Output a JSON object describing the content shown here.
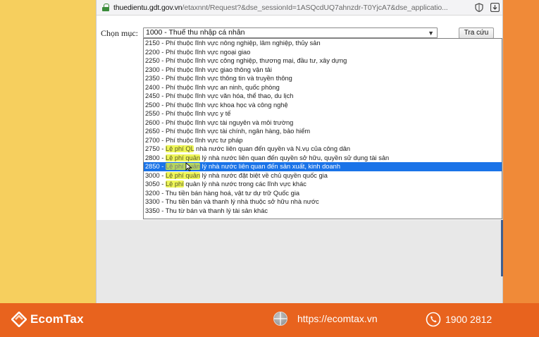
{
  "browser": {
    "url_host": "thuedientu.gdt.gov.vn",
    "url_path": "/etaxnnt/Request?&dse_sessionId=1ASQcdUQ7ahnzdr-T0YjcA7&dse_applicatio..."
  },
  "form": {
    "label": "Chọn mục:",
    "selected_value": "1000 - Thuế thu nhập cá nhân",
    "search_button": "Tra cứu"
  },
  "dropdown": {
    "options": [
      {
        "code": "2150",
        "prefix": "",
        "hl": "",
        "rest": "Phí thuộc lĩnh vực nông nghiệp, lâm nghiệp, thủy sản"
      },
      {
        "code": "2200",
        "prefix": "",
        "hl": "",
        "rest": "Phí thuộc lĩnh vực ngoại giao"
      },
      {
        "code": "2250",
        "prefix": "",
        "hl": "",
        "rest": "Phí thuộc lĩnh vực công nghiệp, thương mại, đầu tư, xây dựng"
      },
      {
        "code": "2300",
        "prefix": "",
        "hl": "",
        "rest": "Phí thuộc lĩnh vực giao thông vận tải"
      },
      {
        "code": "2350",
        "prefix": "",
        "hl": "",
        "rest": "Phí thuộc lĩnh vực thông tin và truyền thông"
      },
      {
        "code": "2400",
        "prefix": "",
        "hl": "",
        "rest": "Phí thuộc lĩnh vực an ninh, quốc phòng"
      },
      {
        "code": "2450",
        "prefix": "",
        "hl": "",
        "rest": "Phí thuộc lĩnh vực văn hóa, thể thao, du lịch"
      },
      {
        "code": "2500",
        "prefix": "",
        "hl": "",
        "rest": "Phí thuộc lĩnh vực khoa học và công nghệ"
      },
      {
        "code": "2550",
        "prefix": "",
        "hl": "",
        "rest": "Phí thuộc lĩnh vực y tế"
      },
      {
        "code": "2600",
        "prefix": "",
        "hl": "",
        "rest": "Phí thuộc lĩnh vực tài nguyên và môi trường"
      },
      {
        "code": "2650",
        "prefix": "",
        "hl": "",
        "rest": "Phí thuộc lĩnh vực tài chính, ngân hàng, bảo hiểm"
      },
      {
        "code": "2700",
        "prefix": "",
        "hl": "",
        "rest": "Phí thuộc lĩnh vực tư pháp"
      },
      {
        "code": "2750",
        "prefix": "",
        "hl": "Lệ phí QL",
        "rest": " nhà nước liên quan đến quyền và N.vụ của công dân"
      },
      {
        "code": "2800",
        "prefix": "",
        "hl": "Lệ phí quản",
        "rest": " lý nhà nước liên quan đến quyền sở hữu, quyền sử dụng tài sản"
      },
      {
        "code": "2850",
        "prefix": "",
        "hl": "Lệ phí quản",
        "rest": " lý nhà nước liên quan đến sản xuất, kinh doanh",
        "selected": true
      },
      {
        "code": "3000",
        "prefix": "",
        "hl": "Lệ phí quản",
        "rest": " lý nhà nước đặt biệt về chủ quyền quốc gia"
      },
      {
        "code": "3050",
        "prefix": "",
        "hl": "Lệ phí",
        "rest": " quản lý nhà nước trong các lĩnh vực khác"
      },
      {
        "code": "3200",
        "prefix": "",
        "hl": "",
        "rest": "Thu tiền bán hàng hoá, vật tư dự trữ Quốc gia"
      },
      {
        "code": "3300",
        "prefix": "",
        "hl": "",
        "rest": "Thu tiền bán và thanh lý nhà thuộc sở hữu nhà nước"
      },
      {
        "code": "3350",
        "prefix": "",
        "hl": "",
        "rest": "Thu từ bán và thanh lý tài sản khác"
      }
    ]
  },
  "footer": {
    "brand": "EcomTax",
    "website": "https://ecomtax.vn",
    "phone": "1900 2812"
  },
  "colors": {
    "selection": "#1a73e8",
    "footer_bg": "#e8631e",
    "highlight": "#ebf53c"
  }
}
